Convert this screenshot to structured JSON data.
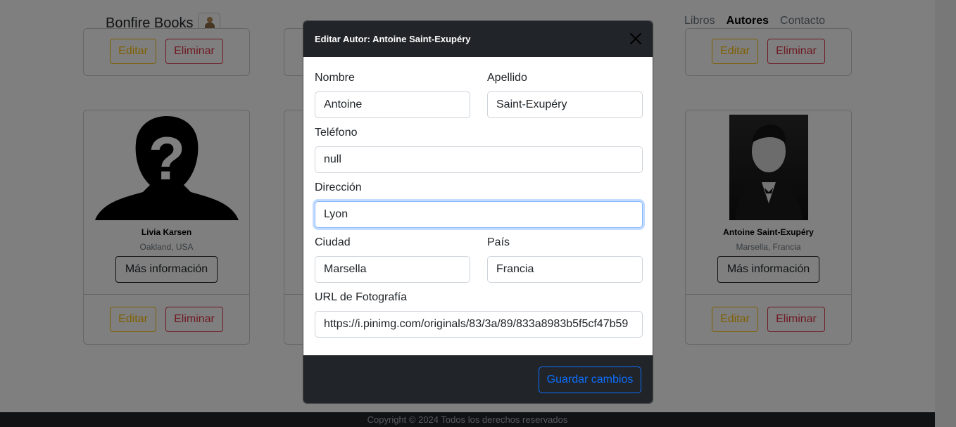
{
  "navbar": {
    "brand": "Bonfire Books",
    "links": [
      "Libros",
      "Autores",
      "Contacto"
    ],
    "active_link": "Autores"
  },
  "cards": {
    "edit_label": "Editar",
    "delete_label": "Eliminar",
    "more_info_label": "Más información",
    "authors": [
      {
        "name": "Livia Karsen",
        "location": "Oakland, USA"
      },
      {
        "name": "Antoine Saint-Exupéry",
        "location": "Marsella, Francia"
      }
    ]
  },
  "footer": {
    "text": "Copyright © 2024 Todos los derechos reservados"
  },
  "modal": {
    "title": "Editar Autor: Antoine Saint-Exupéry",
    "fields": {
      "nombre": {
        "label": "Nombre",
        "value": "Antoine"
      },
      "apellido": {
        "label": "Apellido",
        "value": "Saint-Exupéry"
      },
      "telefono": {
        "label": "Teléfono",
        "value": "null"
      },
      "direccion": {
        "label": "Dirección",
        "value": "Lyon"
      },
      "ciudad": {
        "label": "Ciudad",
        "value": "Marsella"
      },
      "pais": {
        "label": "País",
        "value": "Francia"
      },
      "foto": {
        "label": "URL de Fotografía",
        "value": "https://i.pinimg.com/originals/83/3a/89/833a8983b5f5cf47b59"
      }
    },
    "save_label": "Guardar cambios"
  },
  "colors": {
    "dark": "#212529",
    "edit": "#ffc107",
    "delete": "#dc3545",
    "primary": "#0d6efd"
  },
  "icons": {
    "close": "close-icon",
    "logo": "bonfire-logo-icon"
  }
}
